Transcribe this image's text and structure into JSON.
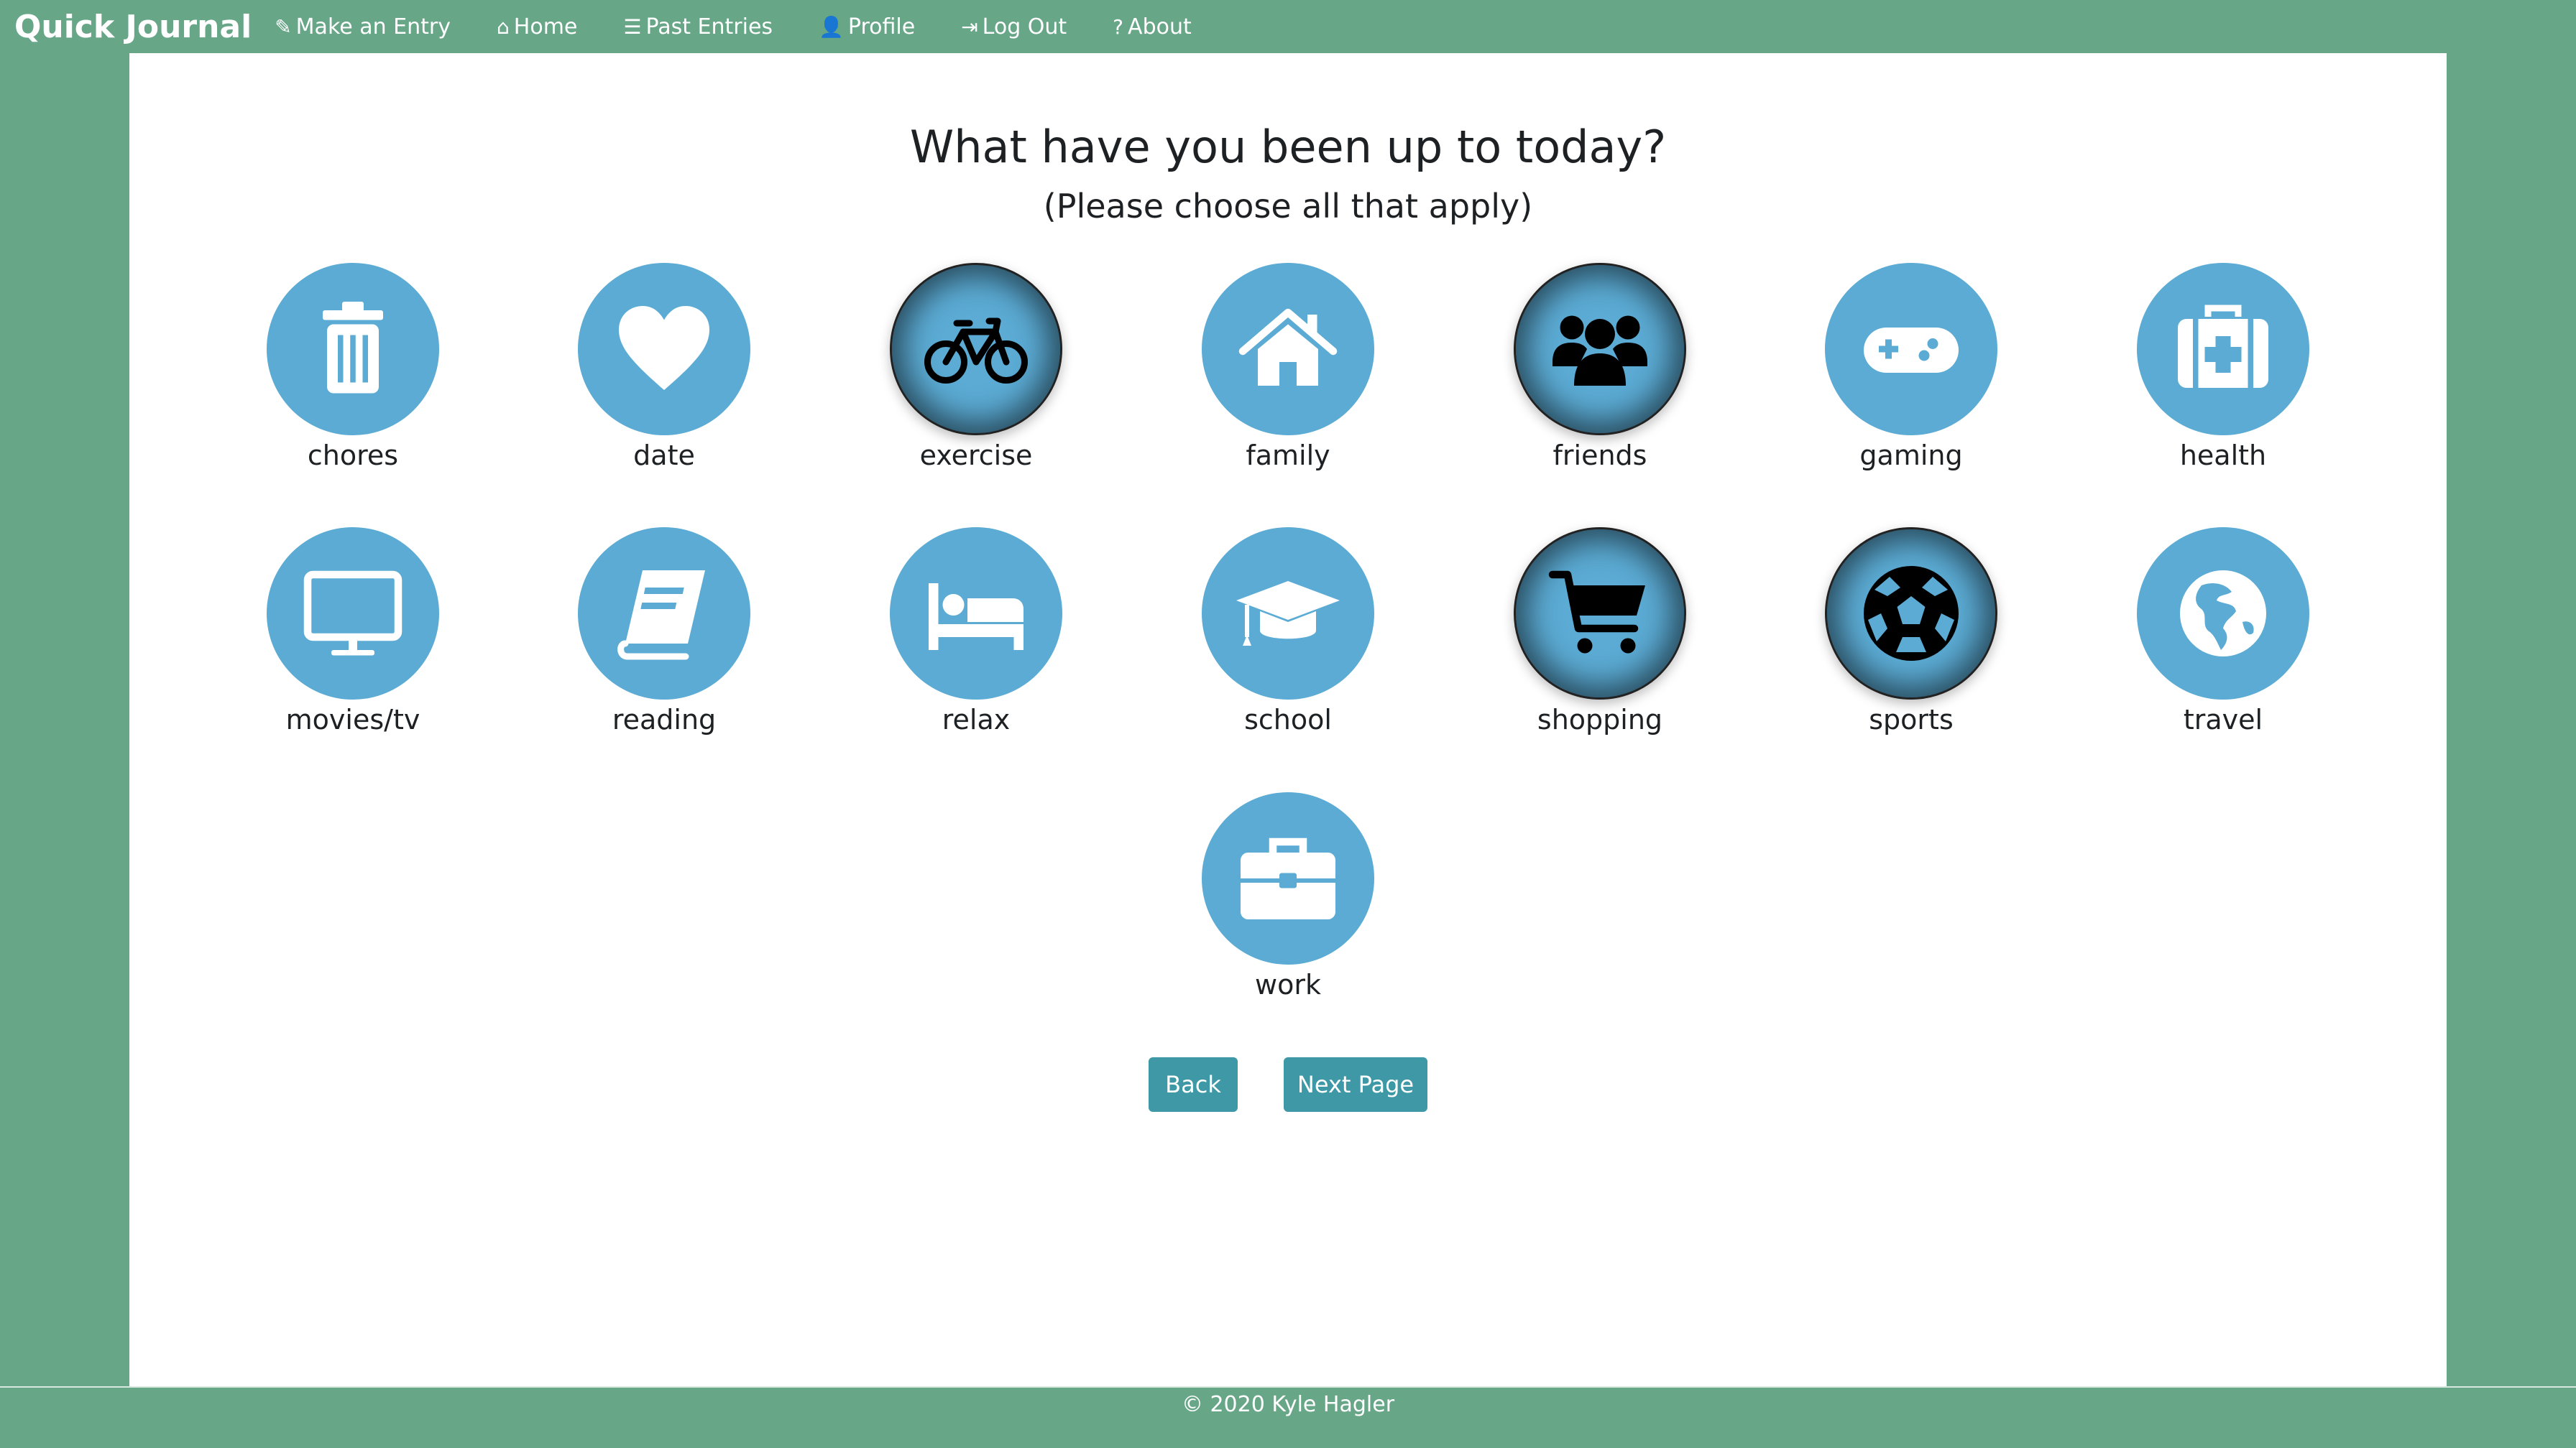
{
  "navbar": {
    "brand": "Quick Journal",
    "items": [
      {
        "label": "Make an Entry",
        "icon": "pencil-icon"
      },
      {
        "label": "Home",
        "icon": "home-icon"
      },
      {
        "label": "Past Entries",
        "icon": "list-icon"
      },
      {
        "label": "Profile",
        "icon": "user-icon"
      },
      {
        "label": "Log Out",
        "icon": "logout-icon"
      },
      {
        "label": "About",
        "icon": "question-icon"
      }
    ]
  },
  "main": {
    "heading": "What have you been up to today?",
    "subheading": "(Please choose all that apply)",
    "activities": [
      {
        "label": "chores",
        "icon": "trash-icon",
        "selected": false
      },
      {
        "label": "date",
        "icon": "heart-icon",
        "selected": false
      },
      {
        "label": "exercise",
        "icon": "bicycle-icon",
        "selected": true
      },
      {
        "label": "family",
        "icon": "house-icon",
        "selected": false
      },
      {
        "label": "friends",
        "icon": "group-icon",
        "selected": true
      },
      {
        "label": "gaming",
        "icon": "gamepad-icon",
        "selected": false
      },
      {
        "label": "health",
        "icon": "medkit-icon",
        "selected": false
      },
      {
        "label": "movies/tv",
        "icon": "monitor-icon",
        "selected": false
      },
      {
        "label": "reading",
        "icon": "book-icon",
        "selected": false
      },
      {
        "label": "relax",
        "icon": "bed-icon",
        "selected": false
      },
      {
        "label": "school",
        "icon": "graduation-cap-icon",
        "selected": false
      },
      {
        "label": "shopping",
        "icon": "cart-icon",
        "selected": true
      },
      {
        "label": "sports",
        "icon": "soccer-ball-icon",
        "selected": true
      },
      {
        "label": "travel",
        "icon": "globe-icon",
        "selected": false
      },
      {
        "label": "work",
        "icon": "briefcase-icon",
        "selected": false
      }
    ],
    "back_label": "Back",
    "next_label": "Next Page"
  },
  "footer": {
    "text": "© 2020 Kyle Hagler"
  },
  "colors": {
    "background": "#68a688",
    "circle": "#5babd4",
    "button": "#3f98a6"
  }
}
